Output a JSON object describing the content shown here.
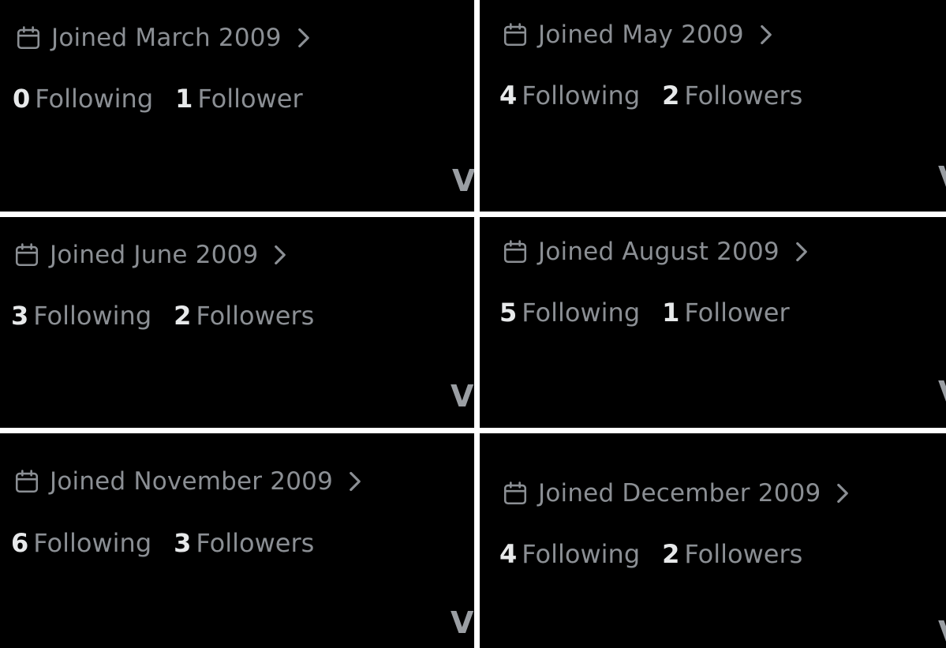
{
  "colors": {
    "background": "#000000",
    "divider": "#ffffff",
    "secondary_text": "#8b8f94",
    "primary_text": "#e7e9ea"
  },
  "icons": {
    "joined": "calendar-icon",
    "more": "chevron-right-icon"
  },
  "cells": [
    {
      "joined": "Joined March 2009",
      "following_count": "0",
      "following_label": "Following",
      "followers_count": "1",
      "followers_label": "Follower",
      "edge": "V"
    },
    {
      "joined": "Joined May 2009",
      "following_count": "4",
      "following_label": "Following",
      "followers_count": "2",
      "followers_label": "Followers",
      "edge": "V"
    },
    {
      "joined": "Joined June 2009",
      "following_count": "3",
      "following_label": "Following",
      "followers_count": "2",
      "followers_label": "Followers",
      "edge": "V"
    },
    {
      "joined": "Joined August 2009",
      "following_count": "5",
      "following_label": "Following",
      "followers_count": "1",
      "followers_label": "Follower",
      "edge": "V"
    },
    {
      "joined": "Joined November 2009",
      "following_count": "6",
      "following_label": "Following",
      "followers_count": "3",
      "followers_label": "Followers",
      "edge": "V"
    },
    {
      "joined": "Joined December 2009",
      "following_count": "4",
      "following_label": "Following",
      "followers_count": "2",
      "followers_label": "Followers",
      "edge": "V"
    }
  ]
}
